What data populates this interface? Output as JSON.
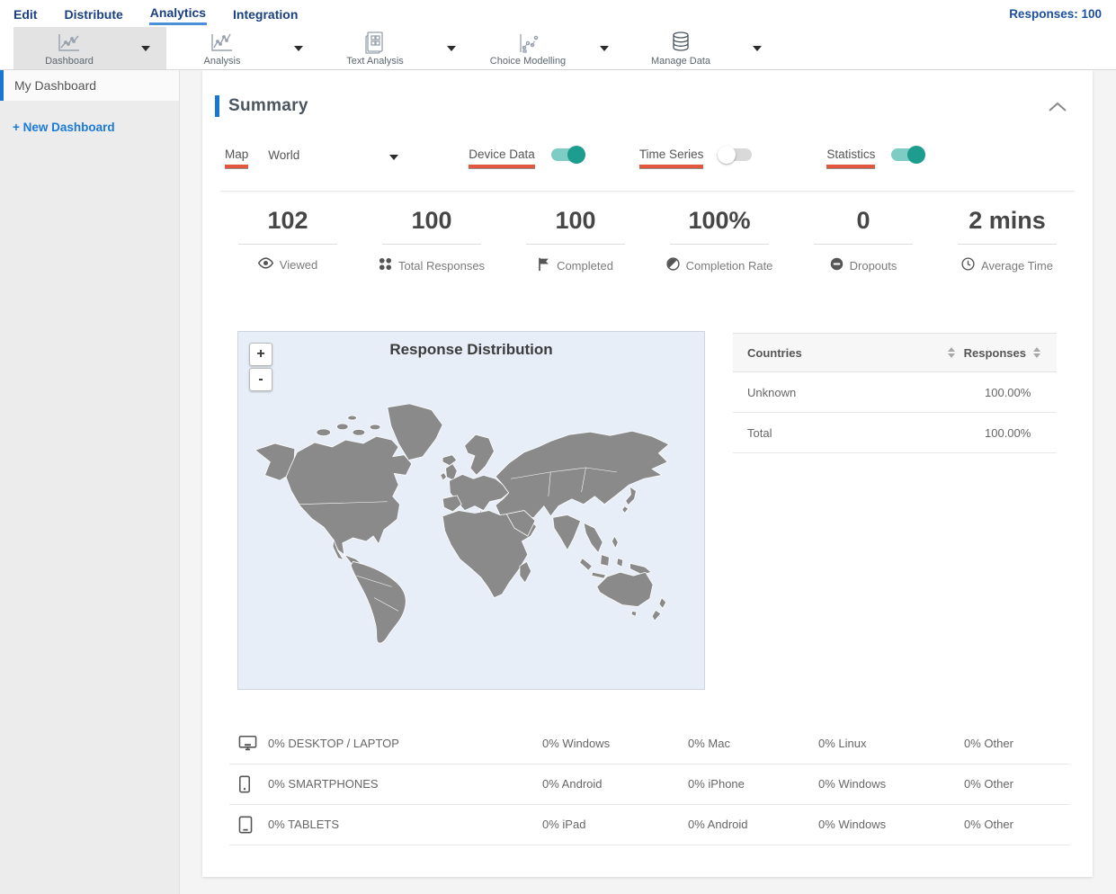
{
  "top_nav": {
    "items": [
      {
        "label": "Edit",
        "active": false
      },
      {
        "label": "Distribute",
        "active": false
      },
      {
        "label": "Analytics",
        "active": true
      },
      {
        "label": "Integration",
        "active": false
      }
    ],
    "responses_label": "Responses: 100"
  },
  "toolbar": {
    "items": [
      {
        "label": "Dashboard",
        "icon": "line-chart-icon",
        "selected": true
      },
      {
        "label": "Analysis",
        "icon": "line-chart-icon",
        "selected": false
      },
      {
        "label": "Text Analysis",
        "icon": "document-grid-icon",
        "selected": false
      },
      {
        "label": "Choice Modelling",
        "icon": "scatter-chart-icon",
        "selected": false
      },
      {
        "label": "Manage Data",
        "icon": "database-icon",
        "selected": false
      }
    ]
  },
  "sidebar": {
    "items": [
      {
        "label": "My Dashboard",
        "active": true
      }
    ],
    "new_dashboard_label": "+ New Dashboard"
  },
  "summary": {
    "title": "Summary",
    "controls": {
      "map_label": "Map",
      "map_value": "World",
      "toggles": [
        {
          "label": "Device Data",
          "on": true
        },
        {
          "label": "Time Series",
          "on": false
        },
        {
          "label": "Statistics",
          "on": true
        }
      ]
    },
    "stats": [
      {
        "value": "102",
        "label": "Viewed",
        "icon": "eye-icon"
      },
      {
        "value": "100",
        "label": "Total Responses",
        "icon": "dots-icon"
      },
      {
        "value": "100",
        "label": "Completed",
        "icon": "flag-icon"
      },
      {
        "value": "100%",
        "label": "Completion Rate",
        "icon": "contrast-icon"
      },
      {
        "value": "0",
        "label": "Dropouts",
        "icon": "minus-circle-icon"
      },
      {
        "value": "2 mins",
        "label": "Average Time",
        "icon": "clock-icon"
      }
    ],
    "map_panel": {
      "title": "Response Distribution",
      "zoom_in": "+",
      "zoom_out": "-"
    },
    "countries_table": {
      "columns": [
        "Countries",
        "Responses"
      ],
      "rows": [
        {
          "country": "Unknown",
          "responses": "100.00%"
        },
        {
          "country": "Total",
          "responses": "100.00%"
        }
      ]
    },
    "device_table": {
      "rows": [
        {
          "icon": "desktop-icon",
          "label": "0% DESKTOP / LAPTOP",
          "cells": [
            "0% Windows",
            "0% Mac",
            "0% Linux",
            "0% Other"
          ]
        },
        {
          "icon": "smartphone-icon",
          "label": "0% SMARTPHONES",
          "cells": [
            "0% Android",
            "0% iPhone",
            "0% Windows",
            "0% Other"
          ]
        },
        {
          "icon": "tablet-icon",
          "label": "0% TABLETS",
          "cells": [
            "0% iPad",
            "0% Android",
            "0% Windows",
            "0% Other"
          ]
        }
      ]
    }
  },
  "colors": {
    "accent_blue": "#1977d4",
    "nav_blue": "#1a4080",
    "toggle_on": "#1d9d8f",
    "red_underline": "#e3573e",
    "map_bg": "#e7eef8",
    "map_land": "#8a8a8a"
  }
}
